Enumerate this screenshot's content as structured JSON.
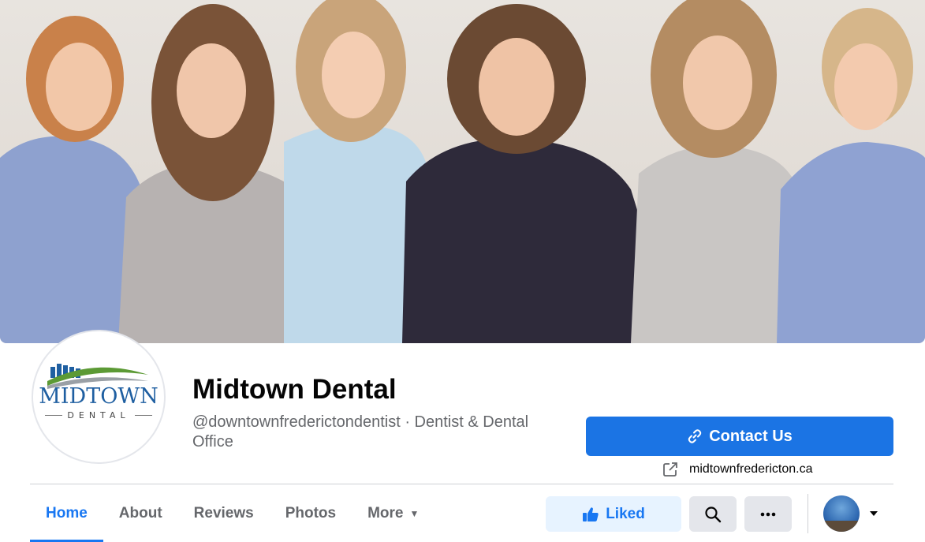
{
  "page": {
    "name": "Midtown Dental",
    "username_category": "@downtownfrederictondentist · Dentist & Dental Office",
    "logo": {
      "word": "MIDTOWN",
      "sub": "DENTAL"
    }
  },
  "actions": {
    "contact_label": "Contact Us",
    "website": "midtownfredericton.ca",
    "liked_label": "Liked"
  },
  "tabs": [
    {
      "label": "Home",
      "active": true
    },
    {
      "label": "About"
    },
    {
      "label": "Reviews"
    },
    {
      "label": "Photos"
    },
    {
      "label": "More"
    }
  ],
  "colors": {
    "accent": "#1877f2",
    "button": "#1b74e4",
    "liked_bg": "#e7f3ff"
  },
  "icons": [
    "link-icon",
    "external-link-icon",
    "thumbs-up-icon",
    "search-icon",
    "more-icon",
    "caret-down-icon"
  ]
}
